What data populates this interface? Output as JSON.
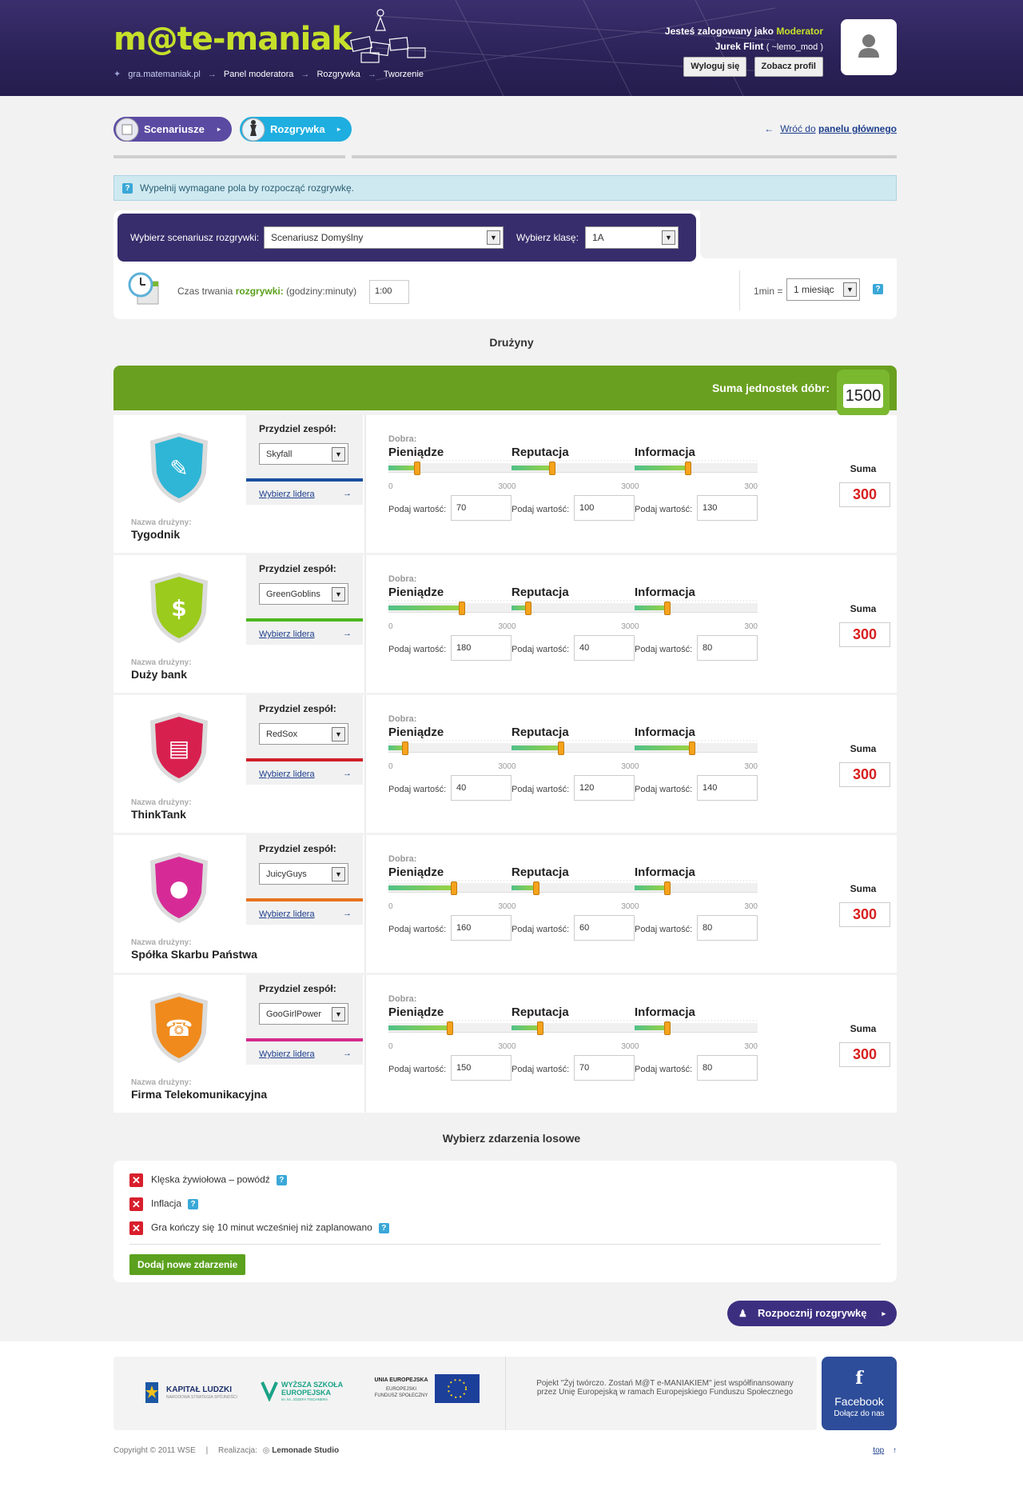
{
  "header": {
    "logo": "m@te-maniak",
    "breadcrumbs": [
      "gra.matemaniak.pl",
      "Panel moderatora",
      "Rozgrywka",
      "Tworzenie"
    ],
    "login_prefix": "Jesteś zalogowany jako",
    "login_role": "Moderator",
    "user_name": "Jurek Flint",
    "user_login": "( ~lemo_mod )",
    "logout_label": "Wyloguj się",
    "profile_label": "Zobacz profil"
  },
  "tabs": {
    "scenarios": "Scenariusze",
    "game": "Rozgrywka",
    "back_prefix": "Wróć do",
    "back_link": "panelu głównego"
  },
  "info": {
    "message": "Wypełnij wymagane pola by rozpocząć rozgrywkę."
  },
  "setup": {
    "scenario_label": "Wybierz scenariusz rozgrywki:",
    "scenario_value": "Scenariusz Domyślny",
    "class_label": "Wybierz klasę:",
    "class_value": "1A",
    "duration_prefix": "Czas trwania",
    "duration_highlight": "rozgrywki:",
    "duration_suffix": "(godziny:minuty)",
    "duration_value": "1:00",
    "ratio_label": "1min =",
    "ratio_value": "1 miesiąc"
  },
  "teams_section": {
    "title": "Drużyny",
    "total_label": "Suma jednostek dóbr:",
    "total_value": "1500",
    "assign_label": "Przydziel zespół:",
    "leader_label": "Wybierz lidera",
    "team_name_label": "Nazwa drużyny:",
    "goods_label": "Dobra:",
    "value_label": "Podaj wartość:",
    "sum_label": "Suma",
    "scale_min": "0",
    "scale_max": "300",
    "resources": [
      "Pieniądze",
      "Reputacja",
      "Informacja"
    ]
  },
  "teams": [
    {
      "name": "Tygodnik",
      "group": "Skyfall",
      "stripe": "#1a4ea0",
      "shield": "#2fb6d6",
      "icon": "pencil-icon",
      "values": [
        70,
        100,
        130
      ],
      "sum": "300"
    },
    {
      "name": "Duży bank",
      "group": "GreenGoblins",
      "stripe": "#4cb81f",
      "shield": "#9bcb1c",
      "icon": "dollar-icon",
      "values": [
        180,
        40,
        80
      ],
      "sum": "300"
    },
    {
      "name": "ThinkTank",
      "group": "RedSox",
      "stripe": "#d0202a",
      "shield": "#d8204f",
      "icon": "notebook-icon",
      "values": [
        40,
        120,
        140
      ],
      "sum": "300"
    },
    {
      "name": "Spółka Skarbu Państwa",
      "group": "JuicyGuys",
      "stripe": "#e6731e",
      "shield": "#d62b97",
      "icon": "piggy-bank-icon",
      "values": [
        160,
        60,
        80
      ],
      "sum": "300"
    },
    {
      "name": "Firma Telekomunikacyjna",
      "group": "GooGirlPower",
      "stripe": "#d52b8d",
      "shield": "#f08a1c",
      "icon": "phone-icon",
      "values": [
        150,
        70,
        80
      ],
      "sum": "300"
    }
  ],
  "events": {
    "title": "Wybierz zdarzenia losowe",
    "items": [
      "Klęska żywiołowa – powódź",
      "Inflacja",
      "Gra kończy się 10 minut wcześniej niż zaplanowano"
    ],
    "add_label": "Dodaj nowe zdarzenie"
  },
  "start_label": "Rozpocznij rozgrywkę",
  "footer": {
    "kl_title": "KAPITAŁ LUDZKI",
    "kl_sub": "NARODOWA STRATEGIA SPÓJNOŚCI",
    "wse_title": "WYŻSZA SZKOŁA EUROPEJSKA",
    "wse_sub": "im. ks. JÓZEFA TISCHNERA",
    "eu_title": "UNIA EUROPEJSKA",
    "eu_sub1": "EUROPEJSKI",
    "eu_sub2": "FUNDUSZ SPOŁECZNY",
    "project_text": "Pojekt \"Żyj twórczo. Zostań M@T e-MANIAKIEM\" jest współfinansowany przez Unię Europejską w ramach Europejskiego Funduszu Społecznego",
    "fb_title": "Facebook",
    "fb_sub": "Dołącz do nas",
    "copyright": "Copyright © 2011 WSE",
    "separator": "|",
    "realization": "Realizacja:",
    "studio": "Lemonade Studio",
    "top_label": "top"
  }
}
